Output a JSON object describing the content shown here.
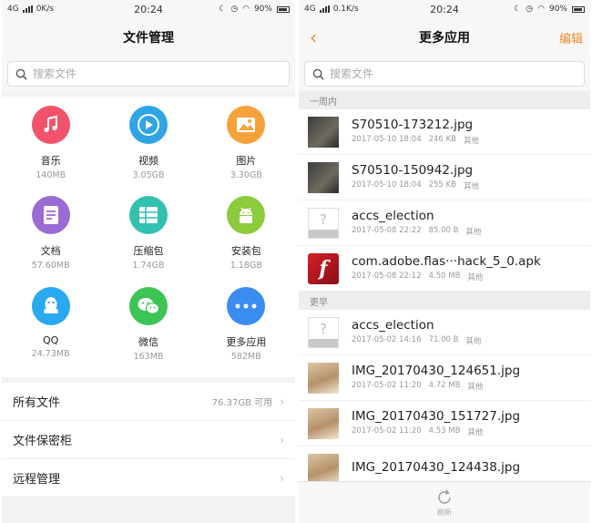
{
  "left": {
    "status": {
      "network": "4G",
      "speed": "0K/s",
      "time": "20:24",
      "battery": "90%"
    },
    "title": "文件管理",
    "search_placeholder": "搜索文件",
    "categories": [
      {
        "name": "音乐",
        "size": "140MB",
        "color": "#f0536b",
        "icon": "music-icon"
      },
      {
        "name": "视频",
        "size": "3.05GB",
        "color": "#2fa4e7",
        "icon": "video-icon"
      },
      {
        "name": "图片",
        "size": "3.30GB",
        "color": "#f6a23b",
        "icon": "image-icon"
      },
      {
        "name": "文档",
        "size": "57.60MB",
        "color": "#9b6bd4",
        "icon": "document-icon"
      },
      {
        "name": "压缩包",
        "size": "1.74GB",
        "color": "#32c1b0",
        "icon": "archive-icon"
      },
      {
        "name": "安装包",
        "size": "1.18GB",
        "color": "#8ccb3b",
        "icon": "android-icon"
      },
      {
        "name": "QQ",
        "size": "24.73MB",
        "color": "#29a9ef",
        "icon": "qq-icon"
      },
      {
        "name": "微信",
        "size": "163MB",
        "color": "#3cc455",
        "icon": "wechat-icon"
      },
      {
        "name": "更多应用",
        "size": "582MB",
        "color": "#3a8cf0",
        "icon": "more-icon"
      }
    ],
    "rows": [
      {
        "label": "所有文件",
        "meta": "76.37GB 可用"
      },
      {
        "label": "文件保密柜",
        "meta": ""
      },
      {
        "label": "远程管理",
        "meta": ""
      }
    ]
  },
  "right": {
    "status": {
      "network": "4G",
      "speed": "0.1K/s",
      "time": "20:24",
      "battery": "90%"
    },
    "back": "‹",
    "title": "更多应用",
    "edit": "编辑",
    "search_placeholder": "搜索文件",
    "sections": [
      {
        "title": "一周内",
        "files": [
          {
            "name": "S70510-173212.jpg",
            "date": "2017-05-10 18:04",
            "size": "246 KB",
            "type": "其他",
            "thumb": "photo-dark"
          },
          {
            "name": "S70510-150942.jpg",
            "date": "2017-05-10 18:04",
            "size": "255 KB",
            "type": "其他",
            "thumb": "photo-dark"
          },
          {
            "name": "accs_election",
            "date": "2017-05-08 22:22",
            "size": "85.00 B",
            "type": "其他",
            "thumb": "unknown"
          },
          {
            "name": "com.adobe.flas···hack_5_0.apk",
            "date": "2017-05-08 22:12",
            "size": "4.50 MB",
            "type": "其他",
            "thumb": "flash"
          }
        ]
      },
      {
        "title": "更早",
        "files": [
          {
            "name": "accs_election",
            "date": "2017-05-02 14:16",
            "size": "71.00 B",
            "type": "其他",
            "thumb": "unknown"
          },
          {
            "name": "IMG_20170430_124651.jpg",
            "date": "2017-05-02 11:20",
            "size": "4.72 MB",
            "type": "其他",
            "thumb": "photo-face"
          },
          {
            "name": "IMG_20170430_151727.jpg",
            "date": "2017-05-02 11:20",
            "size": "4.53 MB",
            "type": "其他",
            "thumb": "photo-face"
          },
          {
            "name": "IMG_20170430_124438.jpg",
            "date": "",
            "size": "",
            "type": "",
            "thumb": "photo-face"
          }
        ]
      }
    ],
    "refresh_label": "刷新"
  }
}
